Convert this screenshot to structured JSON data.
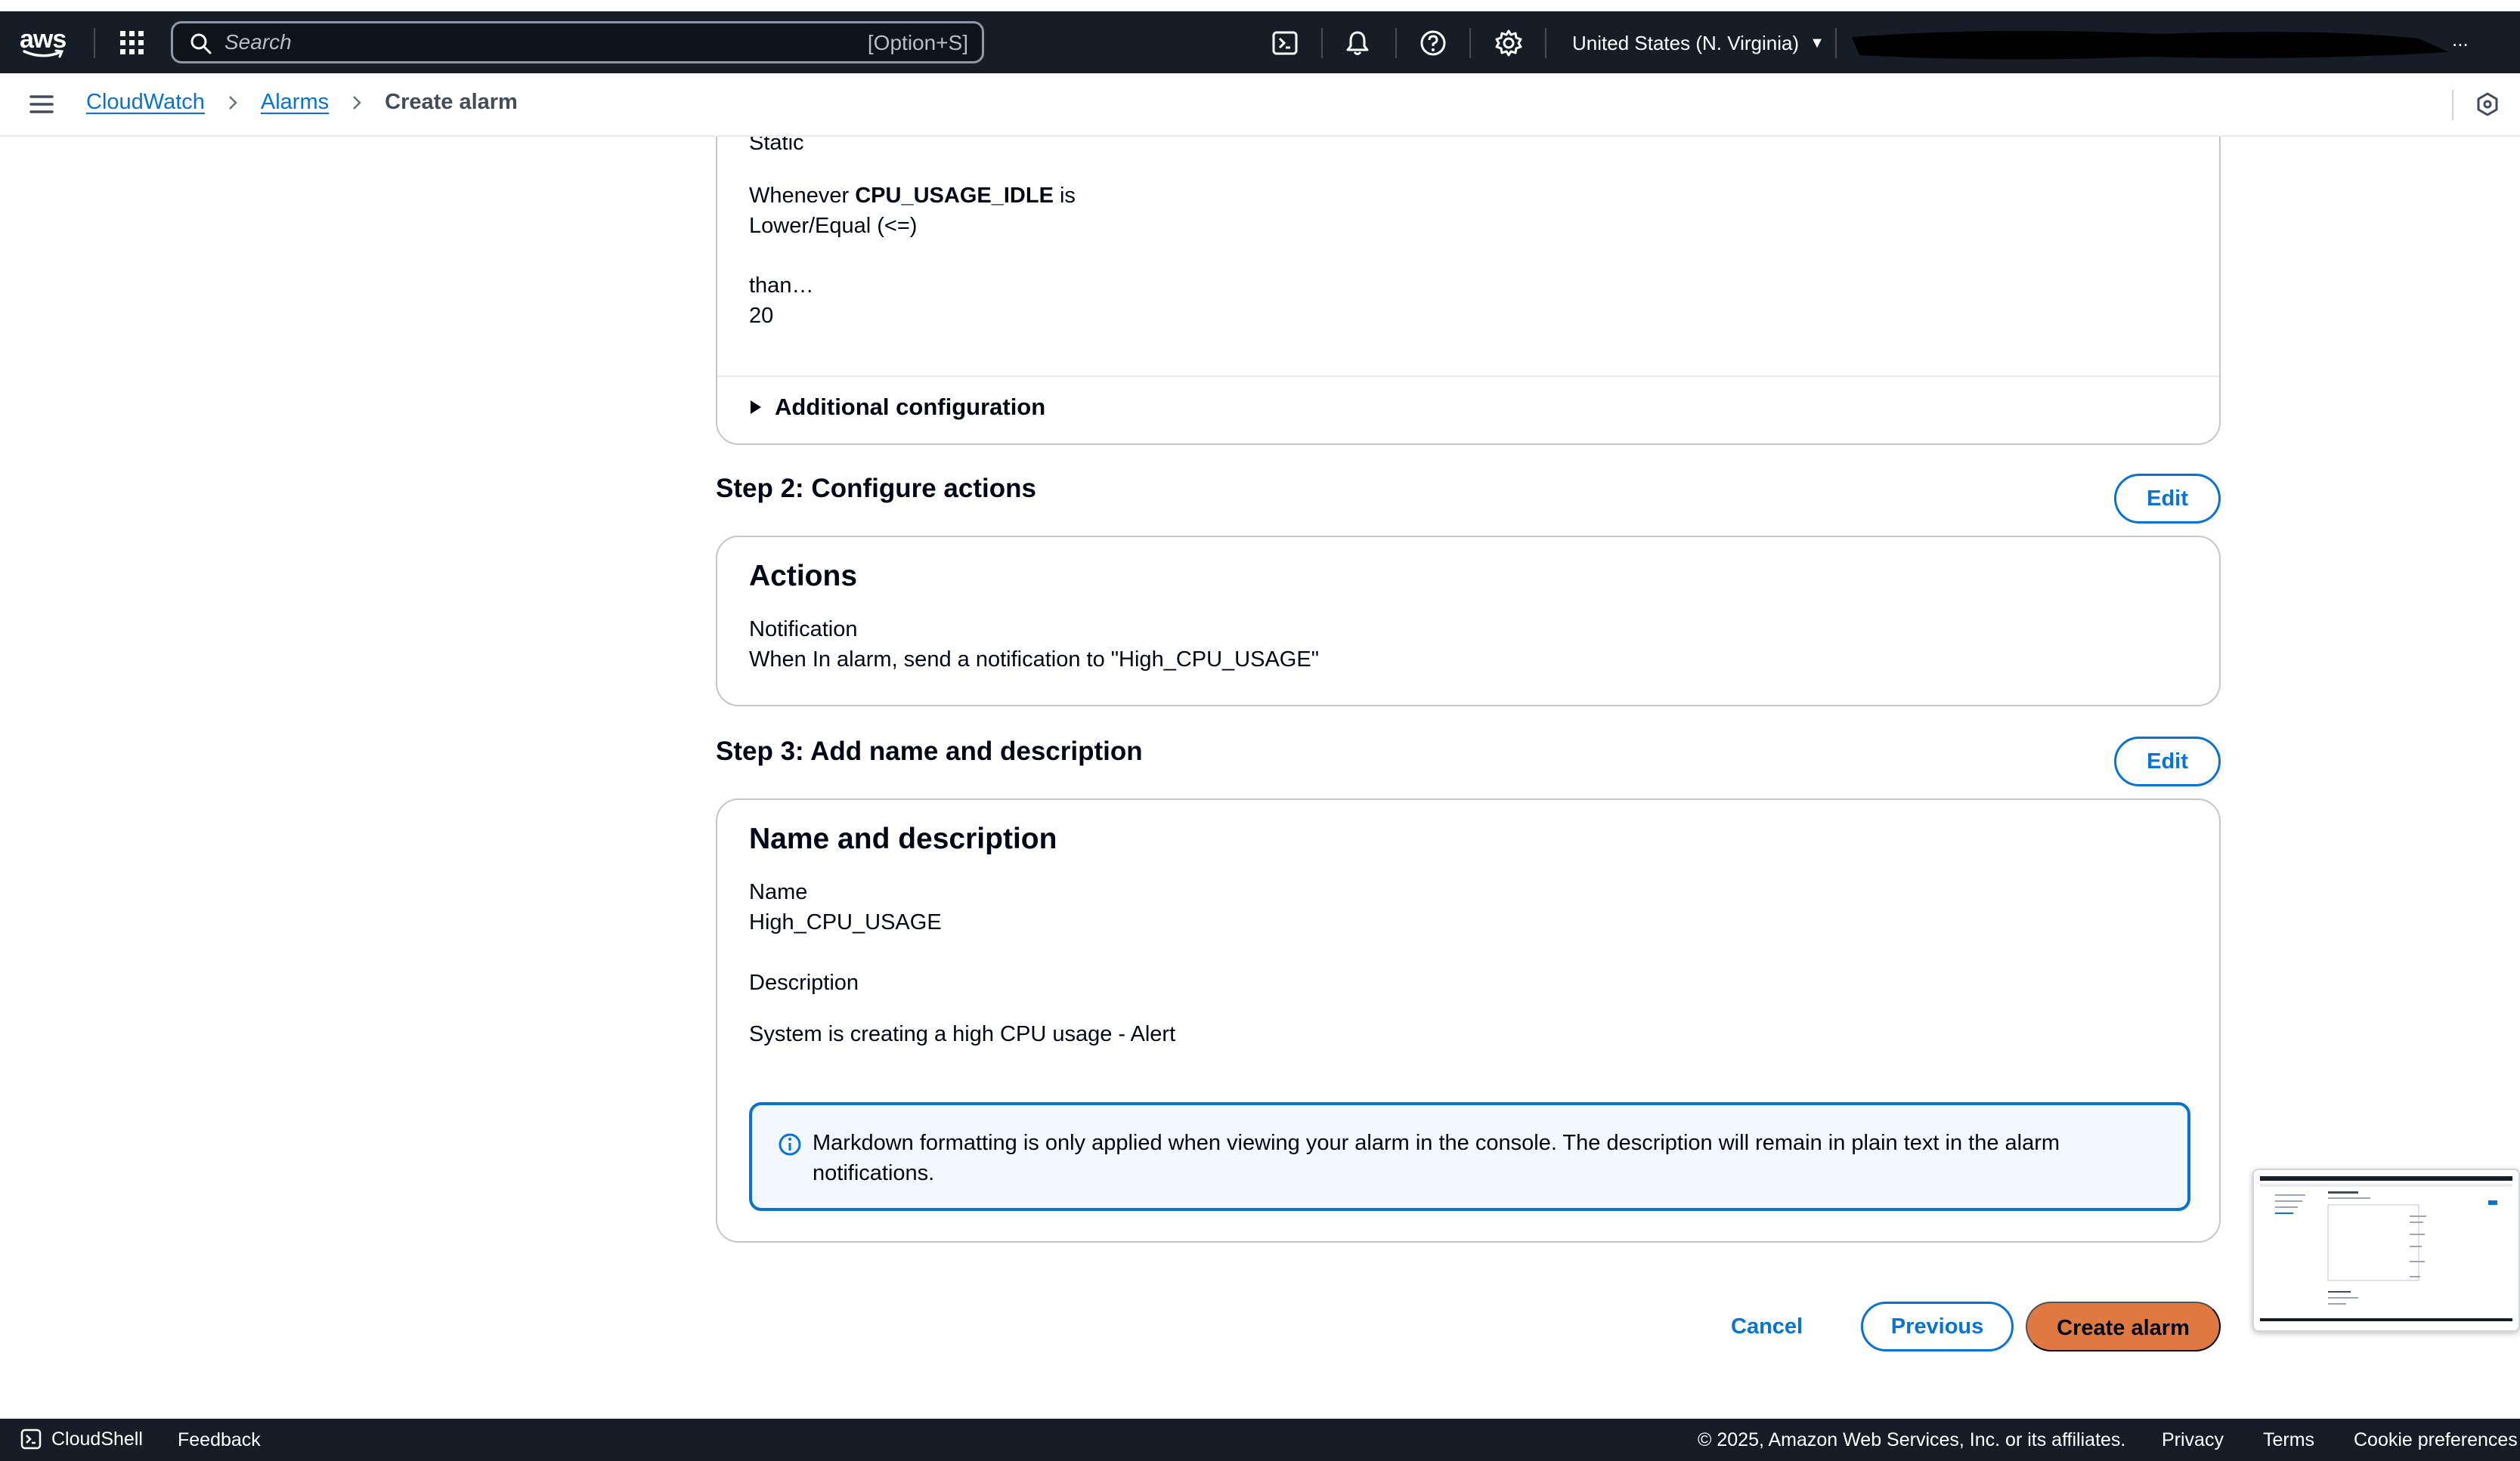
{
  "header": {
    "logo_text": "aws",
    "search_placeholder": "Search",
    "search_shortcut": "[Option+S]",
    "region": "United States (N. Virginia)",
    "account_tail": "..."
  },
  "breadcrumb": {
    "items": [
      "CloudWatch",
      "Alarms"
    ],
    "current": "Create alarm"
  },
  "step1": {
    "partial_line": "Static",
    "whenever_prefix": "Whenever",
    "metric": "CPU_USAGE_IDLE",
    "is_word": "is",
    "comparison": "Lower/Equal (<=)",
    "than_label": "than…",
    "threshold": "20",
    "additional_configuration": "Additional configuration"
  },
  "step2": {
    "title": "Step 2: Configure actions",
    "edit_label": "Edit",
    "card_title": "Actions",
    "notification_label": "Notification",
    "notification_value": "When In alarm, send a notification to \"High_CPU_USAGE\""
  },
  "step3": {
    "title": "Step 3: Add name and description",
    "edit_label": "Edit",
    "card_title": "Name and description",
    "name_label": "Name",
    "name_value": "High_CPU_USAGE",
    "description_label": "Description",
    "description_value": "System is creating a high CPU usage - Alert",
    "info_message": "Markdown formatting is only applied when viewing your alarm in the console. The description will remain in plain text in the alarm notifications."
  },
  "actions": {
    "cancel": "Cancel",
    "previous": "Previous",
    "create": "Create alarm"
  },
  "footer": {
    "cloudshell": "CloudShell",
    "feedback": "Feedback",
    "copyright": "© 2025, Amazon Web Services, Inc. or its affiliates.",
    "privacy": "Privacy",
    "terms": "Terms",
    "cookie": "Cookie preferences"
  },
  "colors": {
    "header_bg": "#161d26",
    "link_blue": "#0972d3",
    "primary_orange": "#e07941",
    "info_bg": "#f2f8fd",
    "card_border": "#c6c6cd"
  }
}
